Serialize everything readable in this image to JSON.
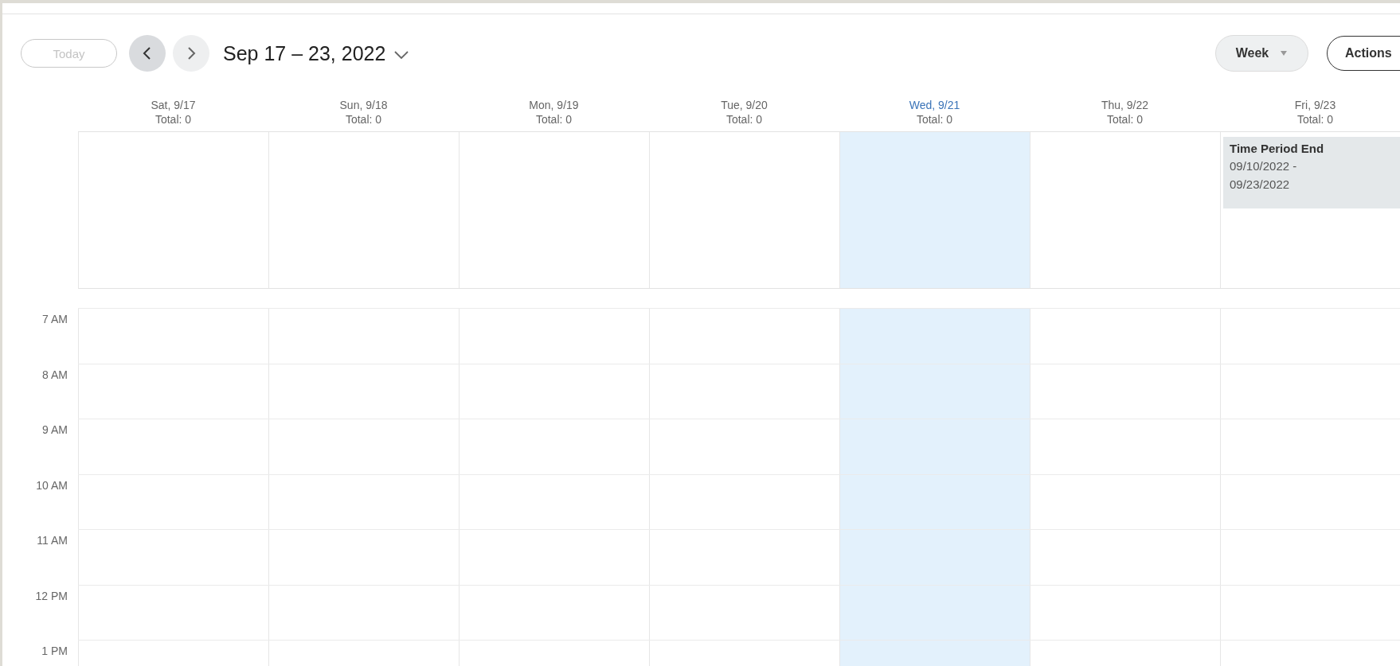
{
  "toolbar": {
    "today": {
      "label": "Today",
      "disabled": true
    },
    "range_title": "Sep 17 – 23, 2022",
    "view": {
      "label": "Week"
    },
    "actions": {
      "label": "Actions"
    }
  },
  "days": [
    {
      "label": "Sat, 9/17",
      "total": "Total: 0",
      "selected": false
    },
    {
      "label": "Sun, 9/18",
      "total": "Total: 0",
      "selected": false
    },
    {
      "label": "Mon, 9/19",
      "total": "Total: 0",
      "selected": false
    },
    {
      "label": "Tue, 9/20",
      "total": "Total: 0",
      "selected": false
    },
    {
      "label": "Wed, 9/21",
      "total": "Total: 0",
      "selected": true
    },
    {
      "label": "Thu, 9/22",
      "total": "Total: 0",
      "selected": false
    },
    {
      "label": "Fri, 9/23",
      "total": "Total: 0",
      "selected": false,
      "events": [
        {
          "title": "Time Period End",
          "dates": [
            "09/10/2022 -",
            "09/23/2022"
          ]
        }
      ]
    }
  ],
  "hours": [
    "7 AM",
    "8 AM",
    "9 AM",
    "10 AM",
    "11 AM",
    "12 PM",
    "1 PM"
  ]
}
